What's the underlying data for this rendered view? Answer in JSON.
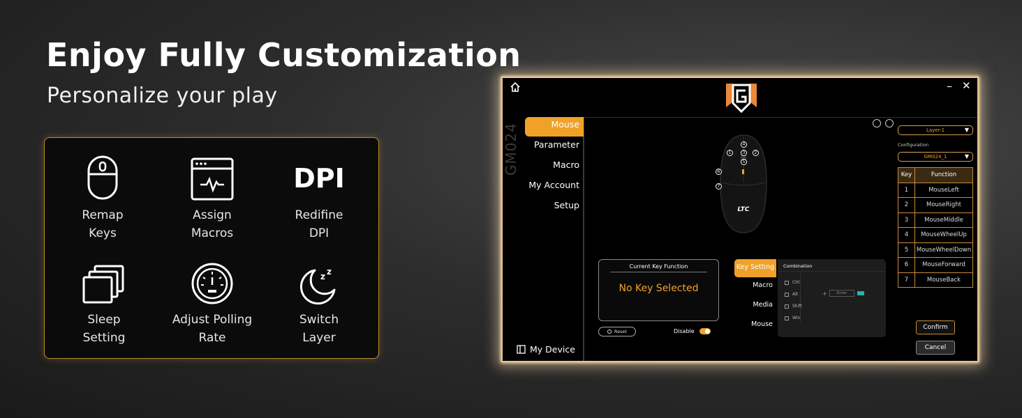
{
  "hero": {
    "title": "Enjoy Fully Customization",
    "subtitle": "Personalize your play"
  },
  "features": [
    {
      "icon": "mouse-icon",
      "line1": "Remap",
      "line2": "Keys"
    },
    {
      "icon": "browser-pulse-icon",
      "line1": "Assign",
      "line2": "Macros"
    },
    {
      "icon_text": "DPI",
      "line1": "Redifine",
      "line2": "DPI"
    },
    {
      "icon": "stacked-windows-icon",
      "line1": "Sleep",
      "line2": "Setting"
    },
    {
      "icon": "gauge-icon",
      "line1": "Adjust Polling",
      "line2": "Rate"
    },
    {
      "icon": "moon-zz-icon",
      "line1": "Switch",
      "line2": "Layer"
    }
  ],
  "app": {
    "model": "GM024",
    "sidebar": [
      "Mouse",
      "Parameter",
      "Macro",
      "My Account",
      "Setup"
    ],
    "my_device": "My Device",
    "layer_select": "Layer-1",
    "configuration_label": "Configuration",
    "configuration_select": "GM024_1",
    "key_table": {
      "headers": [
        "Key",
        "Function"
      ],
      "rows": [
        [
          "1",
          "MouseLeft"
        ],
        [
          "2",
          "MouseRight"
        ],
        [
          "3",
          "MouseMiddle"
        ],
        [
          "4",
          "MouseWheelUp"
        ],
        [
          "5",
          "MouseWheelDown"
        ],
        [
          "6",
          "MouseForward"
        ],
        [
          "7",
          "MouseBack"
        ]
      ]
    },
    "current_key": {
      "title": "Current Key Function",
      "value": "No Key Selected"
    },
    "reset": "Reset",
    "disable": "Disable",
    "key_tabs": [
      "Key Setting",
      "Macro",
      "Media",
      "Mouse"
    ],
    "combination": {
      "title": "Combination",
      "modifiers": [
        "Ctrl",
        "Alt",
        "Shift",
        "Win"
      ],
      "plus": "+",
      "enter": "Enter"
    },
    "confirm": "Confirm",
    "cancel": "Cancel",
    "mouse_brand": "LTC",
    "accent_color": "#f0a12a"
  }
}
